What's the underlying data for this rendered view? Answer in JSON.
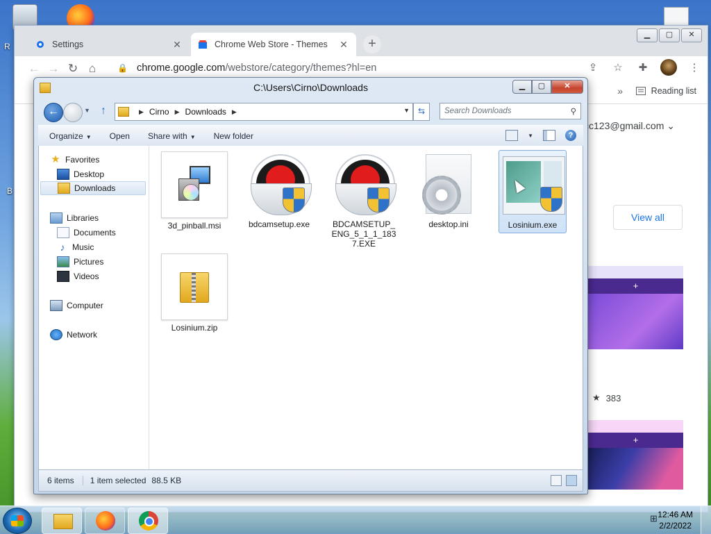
{
  "desktop": {
    "left_letters": [
      "R",
      "B"
    ]
  },
  "chrome": {
    "tabs": [
      {
        "label": "Settings",
        "icon": "gear-icon",
        "close": "✕"
      },
      {
        "label": "Chrome Web Store - Themes",
        "icon": "webstore-icon",
        "close": "✕"
      }
    ],
    "new_tab": "+",
    "window_buttons": {
      "minimize": "▁",
      "maximize": "▢",
      "close": "✕"
    },
    "url_domain": "chrome.google.com",
    "url_path": "/webstore/category/themes?hl=en",
    "reading_list": "Reading list",
    "bookmarks_chevron": "»",
    "page": {
      "email": "cc123@gmail.com",
      "view_all": "View all",
      "band_plus": "+",
      "rating_count": "383"
    }
  },
  "explorer": {
    "title": "C:\\Users\\Cirno\\Downloads",
    "breadcrumb": [
      "Cirno",
      "Downloads"
    ],
    "search_placeholder": "Search Downloads",
    "commands": {
      "organize": "Organize",
      "open": "Open",
      "share_with": "Share with",
      "new_folder": "New folder"
    },
    "nav": {
      "favorites": "Favorites",
      "desktop": "Desktop",
      "downloads": "Downloads",
      "libraries": "Libraries",
      "documents": "Documents",
      "music": "Music",
      "pictures": "Pictures",
      "videos": "Videos",
      "computer": "Computer",
      "network": "Network"
    },
    "files": [
      {
        "name": "3d_pinball.msi"
      },
      {
        "name": "bdcamsetup.exe"
      },
      {
        "name": "BDCAMSETUP_ENG_5_1_1_1837.EXE"
      },
      {
        "name": "desktop.ini"
      },
      {
        "name": "Losinium.exe",
        "selected": true
      },
      {
        "name": "Losinium.zip"
      }
    ],
    "status": {
      "count": "6 items",
      "selection": "1 item selected",
      "size": "88.5 KB"
    }
  },
  "taskbar": {
    "time": "12:46 AM",
    "date": "2/2/2022"
  }
}
